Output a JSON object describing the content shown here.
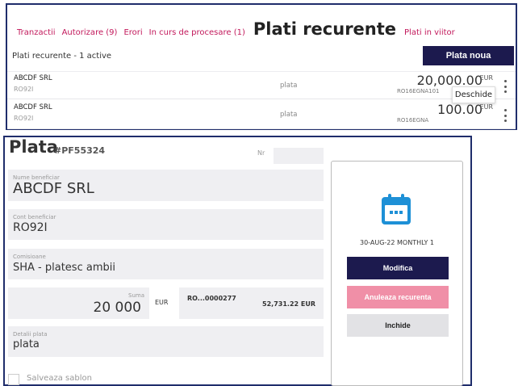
{
  "tabs": [
    {
      "label": "Tranzactii"
    },
    {
      "label": "Autorizare (9)"
    },
    {
      "label": "Erori"
    },
    {
      "label": "In curs de procesare (1)"
    },
    {
      "label": "Plati recurente"
    },
    {
      "label": "Plati in viitor"
    }
  ],
  "list": {
    "subtitle": "Plati recurente - 1 active",
    "new_button": "Plata noua",
    "rows": [
      {
        "name": "ABCDF SRL",
        "iban": "RO92I",
        "detail": "plata",
        "amount": "20,000.00",
        "currency": "EUR",
        "account": "RO16EGNA101"
      },
      {
        "name": "ABCDF SRL",
        "iban": "RO92I",
        "detail": "plata",
        "amount": "100.00",
        "currency": "EUR",
        "account": "RO16EGNA"
      }
    ],
    "tooltip": "Deschide"
  },
  "form": {
    "title": "Plata",
    "code": "#PF55324",
    "nr_label": "Nr",
    "nr_value": "",
    "beneficiary_label": "Nume beneficiar",
    "beneficiary_value": "ABCDF SRL",
    "account_label": "Cont beneficiar",
    "account_value": "RO92I",
    "commission_label": "Comisioane",
    "commission_value": "SHA - platesc ambii",
    "sum_label": "Suma",
    "sum_value": "20 000",
    "currency": "EUR",
    "source_account": "RO...0000277",
    "source_balance": "52,731.22 EUR",
    "details_label": "Detalii plata",
    "details_value": "plata",
    "save_template_label": "Salveaza sablon"
  },
  "side": {
    "schedule": "30-AUG-22 MONTHLY 1",
    "modify_label": "Modifica",
    "cancel_label": "Anuleaza recurenta",
    "close_label": "Inchide"
  },
  "colors": {
    "accent": "#c2185b",
    "primary": "#1c1a4e",
    "calendar": "#1e90d6",
    "danger": "#f08fa7"
  },
  "icons": {
    "calendar": "calendar-icon",
    "more": "kebab-menu-icon"
  }
}
